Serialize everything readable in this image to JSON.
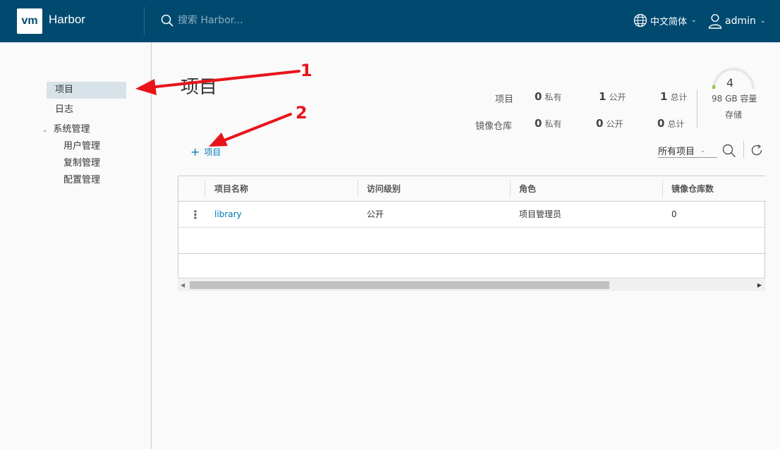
{
  "header": {
    "logo": "vm",
    "brand": "Harbor",
    "search_placeholder": "搜索 Harbor...",
    "language": "中文简体",
    "user": "admin"
  },
  "sidebar": {
    "projects": "项目",
    "logs": "日志",
    "admin": "系统管理",
    "users": "用户管理",
    "replication": "复制管理",
    "configuration": "配置管理"
  },
  "main": {
    "title": "项目",
    "stats": {
      "projects_label": "项目",
      "repos_label": "镜像仓库",
      "project_private": "0",
      "project_public": "1",
      "project_total": "1",
      "repo_private": "0",
      "repo_public": "0",
      "repo_total": "0",
      "private_label": "私有",
      "public_label": "公开",
      "total_label": "总计"
    },
    "storage": {
      "count": "4",
      "capacity": "98 GB 容量",
      "label": "存储"
    },
    "add_project": "项目",
    "filter": "所有项目"
  },
  "table": {
    "columns": [
      "项目名称",
      "访问级别",
      "角色",
      "镜像仓库数"
    ],
    "rows": [
      {
        "name": "library",
        "access": "公开",
        "role": "项目管理员",
        "repos": "0"
      }
    ]
  },
  "annotations": [
    "1",
    "2"
  ],
  "colors": {
    "header_bg": "#004a70",
    "link": "#0079b8",
    "annotation": "#e8141a",
    "nav_active": "#d8e3e9"
  }
}
